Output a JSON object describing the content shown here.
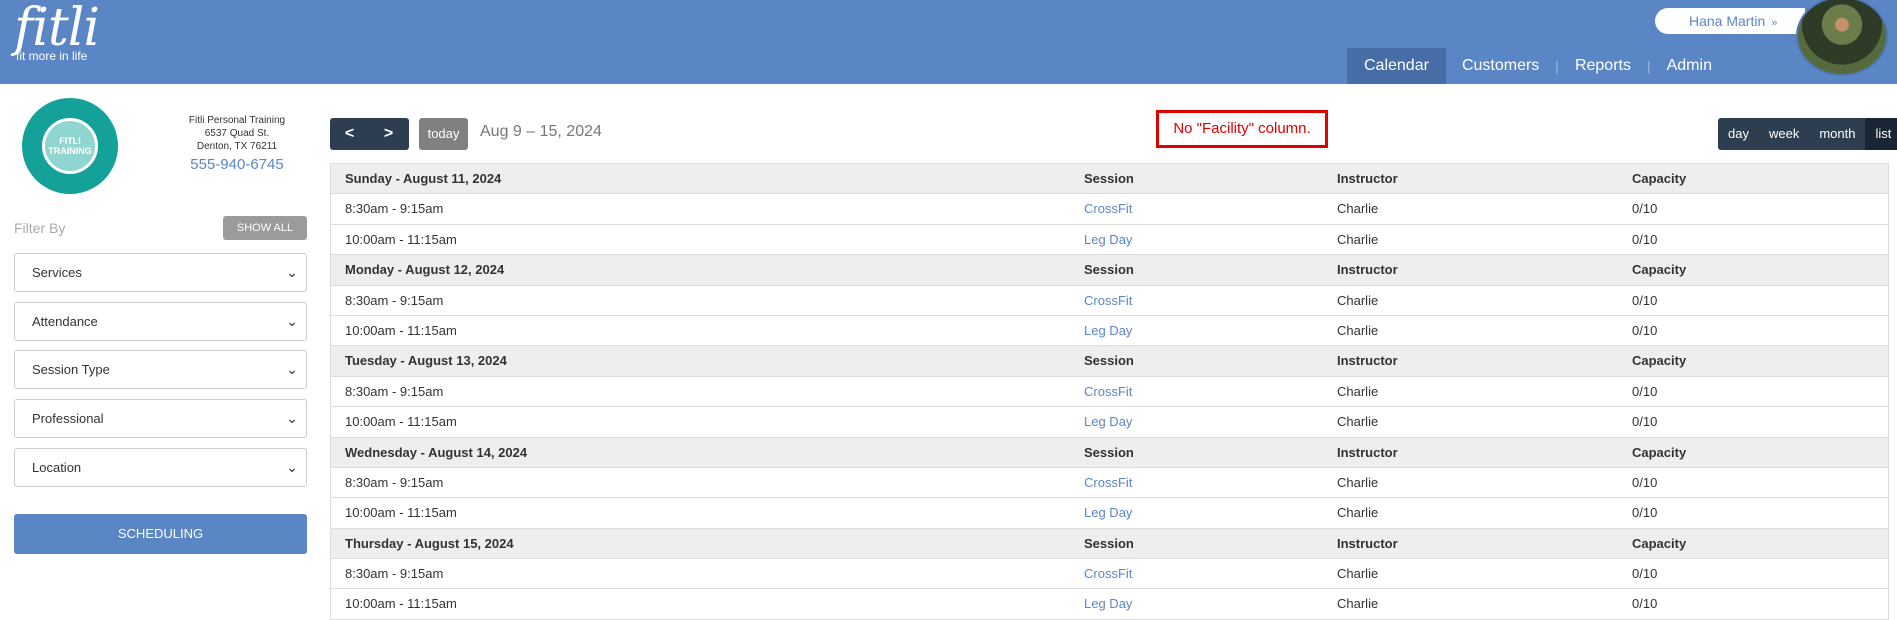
{
  "brand": {
    "name": "fitli",
    "tagline": "fit more in life"
  },
  "user": {
    "name": "Hana Martin"
  },
  "nav": {
    "items": [
      "Calendar",
      "Customers",
      "Reports",
      "Admin"
    ],
    "active": "Calendar"
  },
  "business": {
    "logo_text": "FITLI TRAINING",
    "name": "Fitli Personal Training",
    "address1": "6537 Quad St.",
    "address2": "Denton, TX 76211",
    "phone": "555-940-6745"
  },
  "filters": {
    "label": "Filter By",
    "show_all": "SHOW ALL",
    "selects": [
      "Services",
      "Attendance",
      "Session Type",
      "Professional",
      "Location"
    ]
  },
  "scheduling_label": "SCHEDULING",
  "toolbar": {
    "prev": "<",
    "next": ">",
    "today": "today",
    "date_range": "Aug 9 – 15, 2024",
    "views": [
      "day",
      "week",
      "month",
      "list"
    ],
    "active_view": "list"
  },
  "annotation": "No \"Facility\" column.",
  "columns": {
    "session": "Session",
    "instructor": "Instructor",
    "capacity": "Capacity"
  },
  "days": [
    {
      "label": "Sunday - August 11, 2024",
      "events": [
        {
          "time": "8:30am - 9:15am",
          "session": "CrossFit",
          "instructor": "Charlie",
          "capacity": "0/10"
        },
        {
          "time": "10:00am - 11:15am",
          "session": "Leg Day",
          "instructor": "Charlie",
          "capacity": "0/10"
        }
      ]
    },
    {
      "label": "Monday - August 12, 2024",
      "events": [
        {
          "time": "8:30am - 9:15am",
          "session": "CrossFit",
          "instructor": "Charlie",
          "capacity": "0/10"
        },
        {
          "time": "10:00am - 11:15am",
          "session": "Leg Day",
          "instructor": "Charlie",
          "capacity": "0/10"
        }
      ]
    },
    {
      "label": "Tuesday - August 13, 2024",
      "events": [
        {
          "time": "8:30am - 9:15am",
          "session": "CrossFit",
          "instructor": "Charlie",
          "capacity": "0/10"
        },
        {
          "time": "10:00am - 11:15am",
          "session": "Leg Day",
          "instructor": "Charlie",
          "capacity": "0/10"
        }
      ]
    },
    {
      "label": "Wednesday - August 14, 2024",
      "events": [
        {
          "time": "8:30am - 9:15am",
          "session": "CrossFit",
          "instructor": "Charlie",
          "capacity": "0/10"
        },
        {
          "time": "10:00am - 11:15am",
          "session": "Leg Day",
          "instructor": "Charlie",
          "capacity": "0/10"
        }
      ]
    },
    {
      "label": "Thursday - August 15, 2024",
      "events": [
        {
          "time": "8:30am - 9:15am",
          "session": "CrossFit",
          "instructor": "Charlie",
          "capacity": "0/10"
        },
        {
          "time": "10:00am - 11:15am",
          "session": "Leg Day",
          "instructor": "Charlie",
          "capacity": "0/10"
        }
      ]
    }
  ]
}
